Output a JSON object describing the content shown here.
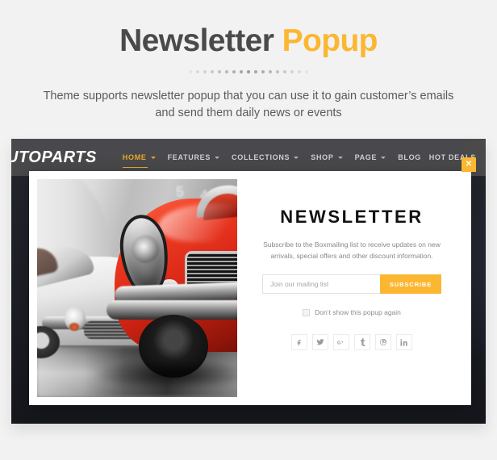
{
  "promo": {
    "title_main": "Newsletter",
    "title_accent": "Popup",
    "subtitle": "Theme supports newsletter popup that you can use it to gain customer’s emails and send them daily news or events",
    "dot_count": 17,
    "accent_color": "#fbb731",
    "title_color": "#4a4a4a",
    "page_background": "#f2f2f2"
  },
  "site": {
    "brand": "UTOPARTS",
    "nav": [
      {
        "label": "HOME",
        "has_caret": true,
        "active": true
      },
      {
        "label": "FEATURES",
        "has_caret": true,
        "active": false
      },
      {
        "label": "COLLECTIONS",
        "has_caret": true,
        "active": false
      },
      {
        "label": "SHOP",
        "has_caret": true,
        "active": false
      },
      {
        "label": "PAGE",
        "has_caret": true,
        "active": false
      },
      {
        "label": "BLOG",
        "has_caret": false,
        "active": false
      }
    ],
    "nav_right": "HOT DEALS",
    "navbar_color": "#4a4a4e"
  },
  "modal": {
    "close_label": "✕",
    "close_color": "#fbb731",
    "photo_alt": "red and white classic sports cars in showroom",
    "heading": "NEWSLETTER",
    "description": "Subscribe to the Boxmailing list to receive updates on new arrivals, special offers and other discount information.",
    "email_placeholder": "Join our mailing list",
    "email_value": "",
    "submit_label": "SUBSCRIBE",
    "dont_show_label": "Don’t show this popup again",
    "dont_show_checked": false,
    "social": [
      {
        "name": "facebook",
        "glyph": "f"
      },
      {
        "name": "twitter",
        "glyph": "t"
      },
      {
        "name": "google-plus",
        "glyph": "G+"
      },
      {
        "name": "tumblr",
        "glyph": "t"
      },
      {
        "name": "pinterest",
        "glyph": "P"
      },
      {
        "name": "linkedin",
        "glyph": "in"
      }
    ]
  }
}
